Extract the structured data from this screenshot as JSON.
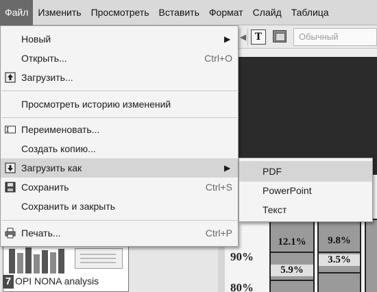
{
  "menubar": {
    "items": [
      "Файл",
      "Изменить",
      "Просмотреть",
      "Вставить",
      "Формат",
      "Слайд",
      "Таблица"
    ]
  },
  "toolbar": {
    "style_select": "Обычный"
  },
  "file_menu": {
    "new": "Новый",
    "open": "Открыть...",
    "open_shortcut": "Ctrl+O",
    "upload": "Загрузить...",
    "history": "Просмотреть историю изменений",
    "rename": "Переименовать...",
    "copy": "Создать копию...",
    "download_as": "Загрузить как",
    "save": "Сохранить",
    "save_shortcut": "Ctrl+S",
    "save_close": "Сохранить и закрыть",
    "print": "Печать...",
    "print_shortcut": "Ctrl+P"
  },
  "submenu": {
    "items": [
      "PDF",
      "PowerPoint",
      "Текст"
    ]
  },
  "chart": {
    "y_ticks": [
      "90%",
      "80%"
    ],
    "bar1": {
      "top": "12.1%",
      "bottom": "5.9%"
    },
    "bar2": {
      "top": "9.8%",
      "bottom": "3.5%"
    }
  },
  "thumbnail": {
    "number": "7",
    "caption": "OPI NONA analysis"
  },
  "colors": {
    "active_menu": "#6a6a6a",
    "highlight": "#d5d5d5",
    "menu_bg": "#f4f4f4"
  }
}
